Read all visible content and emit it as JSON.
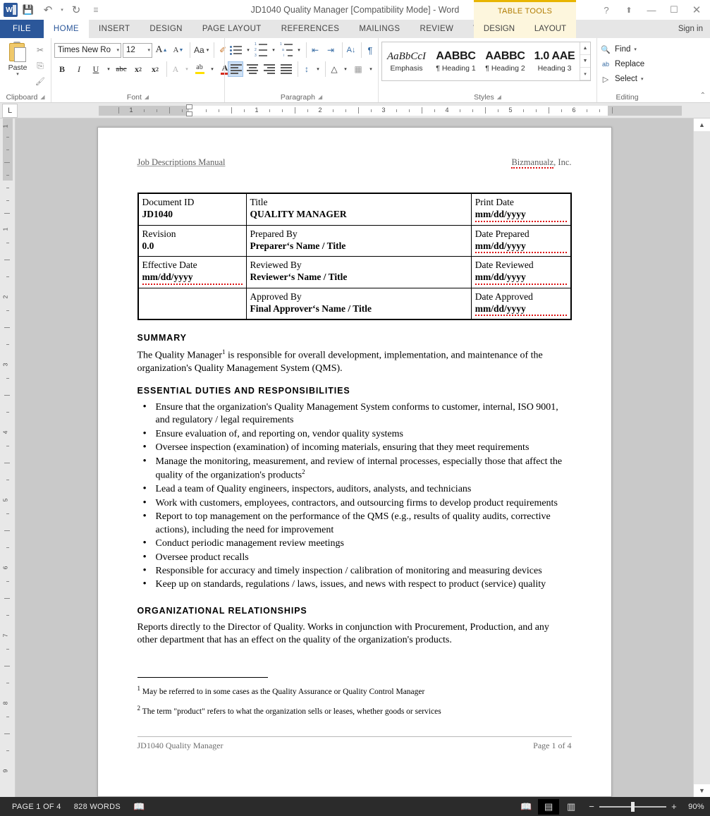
{
  "titlebar": {
    "doc_title": "JD1040 Quality Manager [Compatibility Mode] - Word",
    "word_logo": "W",
    "qat": [
      {
        "name": "save-icon",
        "glyph": "💾"
      },
      {
        "name": "undo-icon",
        "glyph": "↶"
      },
      {
        "name": "undo-dropdown-icon",
        "glyph": "▾"
      },
      {
        "name": "redo-icon",
        "glyph": "↻"
      },
      {
        "name": "customize-qat-icon",
        "glyph": "☰"
      }
    ],
    "contextual_banner": "TABLE TOOLS",
    "window_controls": [
      {
        "name": "help-button",
        "glyph": "?"
      },
      {
        "name": "ribbon-display-options-button",
        "glyph": "⬆"
      },
      {
        "name": "minimize-button",
        "glyph": "—"
      },
      {
        "name": "maximize-button",
        "glyph": "☐"
      },
      {
        "name": "close-button",
        "glyph": "✕"
      }
    ]
  },
  "tabs": {
    "file": "FILE",
    "items": [
      {
        "label": "HOME",
        "active": true
      },
      {
        "label": "INSERT",
        "active": false
      },
      {
        "label": "DESIGN",
        "active": false
      },
      {
        "label": "PAGE LAYOUT",
        "active": false
      },
      {
        "label": "REFERENCES",
        "active": false
      },
      {
        "label": "MAILINGS",
        "active": false
      },
      {
        "label": "REVIEW",
        "active": false
      },
      {
        "label": "VIEW",
        "active": false
      }
    ],
    "contextual": [
      {
        "label": "DESIGN"
      },
      {
        "label": "LAYOUT"
      }
    ],
    "signin": "Sign in"
  },
  "ribbon": {
    "clipboard": {
      "label": "Clipboard",
      "paste_label": "Paste",
      "cut_icon": "✂",
      "copy_icon": "⎘",
      "format_painter_icon": "🖌"
    },
    "font": {
      "label": "Font",
      "font_name": "Times New Ro",
      "font_size": "12",
      "grow_font": "A",
      "shrink_font": "A",
      "change_case": "Aa",
      "clear_formatting": "✐",
      "bold": "B",
      "italic": "I",
      "underline": "U",
      "strikethrough": "abc",
      "subscript": "x",
      "subscript_sub": "2",
      "superscript": "x",
      "superscript_sup": "2",
      "text_effects": "A",
      "highlight": "ab",
      "font_color": "A"
    },
    "paragraph": {
      "label": "Paragraph",
      "bullets": "bullets-icon",
      "numbering": "numbering-icon",
      "multilevel": "multilevel-list-icon",
      "decrease_indent": "⇤",
      "increase_indent": "⇥",
      "sort": "A↓",
      "show_marks": "¶",
      "line_spacing": "↕",
      "shading": "△",
      "borders": "▦"
    },
    "styles": {
      "label": "Styles",
      "items": [
        {
          "preview": "AaBbCcI",
          "name": "Emphasis",
          "kind": "emph"
        },
        {
          "preview": "AABBC",
          "name": "¶ Heading 1",
          "kind": "h"
        },
        {
          "preview": "AABBC",
          "name": "¶ Heading 2",
          "kind": "h"
        },
        {
          "preview": "1.0 AAE",
          "name": "Heading 3",
          "kind": "h"
        }
      ]
    },
    "editing": {
      "label": "Editing",
      "find": "Find",
      "replace": "Replace",
      "select": "Select",
      "find_icon": "🔍",
      "replace_icon": "ab",
      "select_icon": "▷"
    },
    "collapse_icon": "⌃"
  },
  "ruler": {
    "tab_selector": "L",
    "h_numbers": [
      "1",
      "1",
      "2",
      "3",
      "4",
      "5",
      "6"
    ],
    "v_numbers": [
      "1",
      "1",
      "2",
      "3",
      "4",
      "5",
      "6",
      "7",
      "8",
      "9"
    ]
  },
  "document": {
    "header": {
      "left": "Job Descriptions Manual",
      "right": "Bizmanualz, Inc."
    },
    "info_table": [
      [
        {
          "label": "Document ID",
          "value": "JD1040"
        },
        {
          "label": "Title",
          "value": "QUALITY MANAGER"
        },
        {
          "label": "Print Date",
          "value": "mm/dd/yyyy"
        }
      ],
      [
        {
          "label": "Revision",
          "value": "0.0"
        },
        {
          "label": "Prepared By",
          "value": "Preparer‘s Name / Title"
        },
        {
          "label": "Date Prepared",
          "value": "mm/dd/yyyy"
        }
      ],
      [
        {
          "label": "Effective Date",
          "value": "mm/dd/yyyy"
        },
        {
          "label": "Reviewed By",
          "value": "Reviewer‘s Name / Title"
        },
        {
          "label": "Date Reviewed",
          "value": "mm/dd/yyyy"
        }
      ],
      [
        {
          "label": "",
          "value": ""
        },
        {
          "label": "Approved By",
          "value": "Final Approver‘s Name / Title"
        },
        {
          "label": "Date Approved",
          "value": "mm/dd/yyyy"
        }
      ]
    ],
    "summary_heading": "SUMMARY",
    "summary_text_a": "The Quality Manager",
    "summary_sup": "1",
    "summary_text_b": " is responsible for overall development, implementation, and maintenance of the organization's Quality Management System (QMS).",
    "duties_heading": "ESSENTIAL DUTIES AND RESPONSIBILITIES",
    "duties": [
      {
        "text": "Ensure that the organization's Quality Management System conforms to customer, internal, ISO 9001, and regulatory / legal requirements",
        "sup": ""
      },
      {
        "text": "Ensure evaluation of, and reporting on, vendor quality systems",
        "sup": ""
      },
      {
        "text": "Oversee inspection (examination) of incoming materials, ensuring that they meet requirements",
        "sup": ""
      },
      {
        "text": "Manage the monitoring, measurement, and review of internal processes, especially those that affect the quality of the organization's products",
        "sup": "2"
      },
      {
        "text": "Lead a team of Quality engineers, inspectors, auditors, analysts, and technicians",
        "sup": ""
      },
      {
        "text": "Work with customers, employees, contractors, and outsourcing firms to develop product requirements",
        "sup": ""
      },
      {
        "text": "Report to top management on the performance of the QMS (e.g., results of quality audits, corrective actions), including the need for improvement",
        "sup": ""
      },
      {
        "text": "Conduct periodic management review meetings",
        "sup": ""
      },
      {
        "text": "Oversee product recalls",
        "sup": ""
      },
      {
        "text": "Responsible for accuracy and timely inspection / calibration of monitoring and measuring devices",
        "sup": ""
      },
      {
        "text": "Keep up on standards, regulations / laws, issues, and news with respect to product (service) quality",
        "sup": ""
      }
    ],
    "org_heading": "ORGANIZATIONAL RELATIONSHIPS",
    "org_text": "Reports directly to the Director of Quality. Works in conjunction with Procurement, Production, and any other department that has an effect on the quality of the organization's products.",
    "footnotes": [
      {
        "marker": "1",
        "text": "May be referred to in some cases as the Quality Assurance or Quality Control Manager"
      },
      {
        "marker": "2",
        "text": "The term \"product\" refers to what the organization sells or leases, whether goods or services"
      }
    ],
    "footer": {
      "left": "JD1040 Quality Manager",
      "right": "Page 1 of 4"
    }
  },
  "statusbar": {
    "page_status": "PAGE 1 OF 4",
    "word_count": "828 WORDS",
    "proofing_icon": "📖",
    "views": [
      {
        "name": "read-mode",
        "glyph": "📖",
        "active": false
      },
      {
        "name": "print-layout",
        "glyph": "▤",
        "active": true
      },
      {
        "name": "web-layout",
        "glyph": "▥",
        "active": false
      }
    ],
    "zoom_out": "−",
    "zoom_in": "+",
    "zoom_value": "90%"
  },
  "colors": {
    "word_blue": "#2b579a",
    "contextual_yellow": "#e8b500",
    "contextual_bg": "#fdf6dd",
    "status_bg": "#2b2b2b",
    "highlight_yellow": "#ffe000",
    "font_red": "#d42b1e"
  }
}
